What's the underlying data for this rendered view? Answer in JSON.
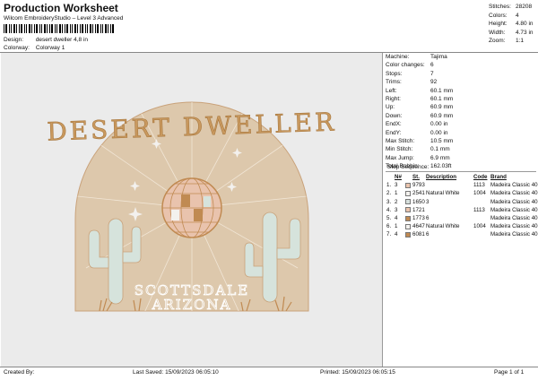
{
  "header": {
    "title": "Production Worksheet",
    "subtitle": "Wilcom EmbroideryStudio – Level 3 Advanced",
    "design_label": "Design:",
    "design_value": "desert dweller 4,8 in",
    "colorway_label": "Colorway:",
    "colorway_value": "Colorway 1"
  },
  "stats": [
    {
      "label": "Stitches:",
      "value": "28208"
    },
    {
      "label": "Colors:",
      "value": "4"
    },
    {
      "label": "Height:",
      "value": "4.80 in"
    },
    {
      "label": "Width:",
      "value": "4.73 in"
    },
    {
      "label": "Zoom:",
      "value": "1:1"
    }
  ],
  "machine_info": [
    {
      "label": "Machine:",
      "value": "Tajima"
    },
    {
      "label": "Color changes:",
      "value": "6"
    },
    {
      "label": "Stops:",
      "value": "7"
    },
    {
      "label": "Trims:",
      "value": "92"
    },
    {
      "label": "Left:",
      "value": "60.1 mm"
    },
    {
      "label": "Right:",
      "value": "60.1 mm"
    },
    {
      "label": "Up:",
      "value": "60.9 mm"
    },
    {
      "label": "Down:",
      "value": "60.9 mm"
    },
    {
      "label": "EndX:",
      "value": "0.00 in"
    },
    {
      "label": "EndY:",
      "value": "0.00 in"
    },
    {
      "label": "Max Stitch:",
      "value": "10.5 mm"
    },
    {
      "label": "Min Stitch:",
      "value": "0.1 mm"
    },
    {
      "label": "Max Jump:",
      "value": "6.9 mm"
    },
    {
      "label": "Total Bobbin:",
      "value": "162.03ft"
    }
  ],
  "stop_sequence": {
    "label": "Stop Sequence:",
    "columns": {
      "n": "N#",
      "st": "St.",
      "description": "Description",
      "code": "Code",
      "brand": "Brand"
    },
    "rows": [
      {
        "idx": "1.",
        "n": "3",
        "swatch": "#e9c3ad",
        "st": "9793",
        "description": "",
        "code": "1113",
        "brand": "Madeira Classic 40"
      },
      {
        "idx": "2.",
        "n": "1",
        "swatch": "#f3f1ee",
        "st": "2541",
        "description": "Natural White",
        "code": "1004",
        "brand": "Madeira Classic 40"
      },
      {
        "idx": "3.",
        "n": "2",
        "swatch": "#d6dfdc",
        "st": "1650",
        "description": "3",
        "code": "",
        "brand": "Madeira Classic 40"
      },
      {
        "idx": "4.",
        "n": "3",
        "swatch": "#e9c3ad",
        "st": "1721",
        "description": "",
        "code": "1113",
        "brand": "Madeira Classic 40"
      },
      {
        "idx": "5.",
        "n": "4",
        "swatch": "#c08a52",
        "st": "1773",
        "description": "6",
        "code": "",
        "brand": "Madeira Classic 40"
      },
      {
        "idx": "6.",
        "n": "1",
        "swatch": "#f3f1ee",
        "st": "4647",
        "description": "Natural White",
        "code": "1004",
        "brand": "Madeira Classic 40"
      },
      {
        "idx": "7.",
        "n": "4",
        "swatch": "#c08a52",
        "st": "6081",
        "description": "6",
        "code": "",
        "brand": "Madeira Classic 40"
      }
    ]
  },
  "design_art": {
    "headline": "DESERT DWELLER",
    "line1": "SCOTTSDALE",
    "line2": "ARIZONA",
    "colors": {
      "sand": "#ddc8ac",
      "gold": "#c9995f",
      "mint": "#d6e3dc",
      "white": "#f3f1ee",
      "ink": "#b68a5b"
    }
  },
  "footer": {
    "created_label": "Created By:",
    "created_value": "",
    "saved_label": "Last Saved:",
    "saved_value": "15/09/2023 06:05:10",
    "printed_label": "Printed:",
    "printed_value": "15/09/2023 06:05:15",
    "page_label": "Page 1 of 1"
  }
}
